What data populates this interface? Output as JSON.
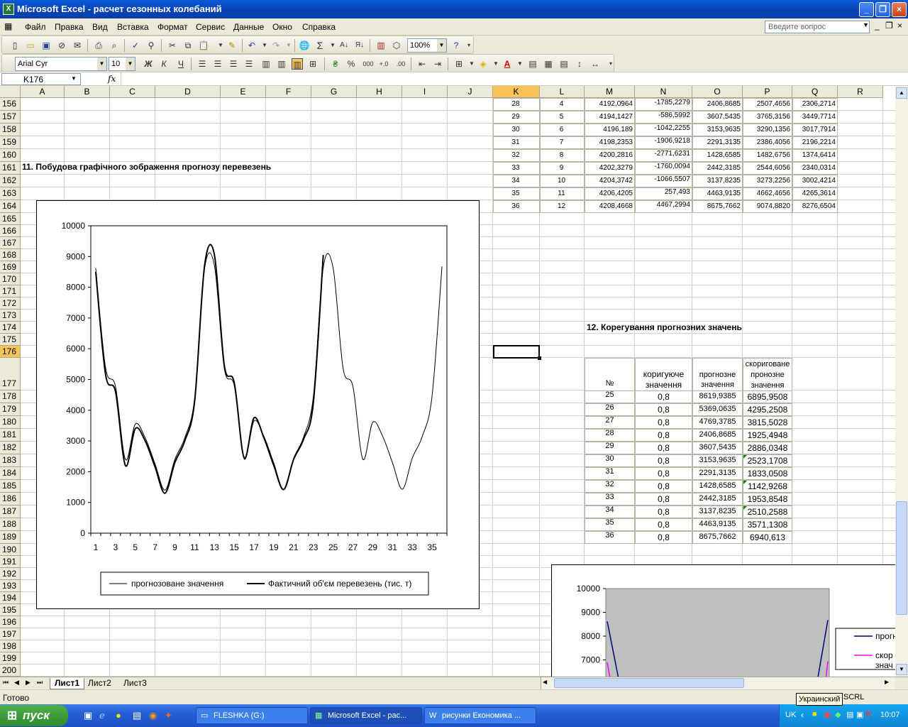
{
  "window": {
    "title": "Microsoft Excel - расчет сезонных колебаний"
  },
  "menu": [
    "Файл",
    "Правка",
    "Вид",
    "Вставка",
    "Формат",
    "Сервис",
    "Данные",
    "Окно",
    "Справка"
  ],
  "ask_placeholder": "Введите вопрос",
  "toolbar": {
    "zoom": "100%",
    "font": "Arial Cyr",
    "size": "10",
    "bold": "Ж",
    "italic": "К",
    "underline": "Ч",
    "percent": "%",
    "thousands": "000",
    "sigma": "Σ"
  },
  "namebox": "K176",
  "fx": "fx",
  "columns": [
    "A",
    "B",
    "C",
    "D",
    "E",
    "F",
    "G",
    "H",
    "I",
    "J",
    "K",
    "L",
    "M",
    "N",
    "O",
    "P",
    "Q",
    "R"
  ],
  "rows": [
    "156",
    "157",
    "158",
    "159",
    "160",
    "161",
    "162",
    "163",
    "164",
    "165",
    "166",
    "167",
    "168",
    "169",
    "170",
    "171",
    "172",
    "173",
    "174",
    "175",
    "176",
    "177",
    "178",
    "179",
    "180",
    "181",
    "182",
    "183",
    "184",
    "185",
    "186",
    "187",
    "188",
    "189",
    "190",
    "191",
    "192",
    "193",
    "194",
    "195",
    "196",
    "197",
    "198",
    "199",
    "200"
  ],
  "heading11": "11. Побудова графічного зображення  прогнозу перевезень",
  "heading12": "12. Корегування прогнозних значень",
  "table_top": [
    [
      "28",
      "4",
      "4192,0964",
      "-1785,2279",
      "2406,8685",
      "2507,4656",
      "2306,2714"
    ],
    [
      "29",
      "5",
      "4194,1427",
      "-586,5992",
      "3607,5435",
      "3765,3156",
      "3449,7714"
    ],
    [
      "30",
      "6",
      "4196,189",
      "-1042,2255",
      "3153,9635",
      "3290,1356",
      "3017,7914"
    ],
    [
      "31",
      "7",
      "4198,2353",
      "-1906,9218",
      "2291,3135",
      "2386,4056",
      "2196,2214"
    ],
    [
      "32",
      "8",
      "4200,2816",
      "-2771,6231",
      "1428,6585",
      "1482,6756",
      "1374,6414"
    ],
    [
      "33",
      "9",
      "4202,3279",
      "-1760,0094",
      "2442,3185",
      "2544,6056",
      "2340,0314"
    ],
    [
      "34",
      "10",
      "4204,3742",
      "-1066,5507",
      "3137,8235",
      "3273,2256",
      "3002,4214"
    ],
    [
      "35",
      "11",
      "4206,4205",
      "257,493",
      "4463,9135",
      "4662,4656",
      "4265,3614"
    ],
    [
      "36",
      "12",
      "4208,4668",
      "4467,2994",
      "8675,7662",
      "9074,8820",
      "8276,6504"
    ]
  ],
  "table2_headers": [
    "№",
    "коригуюче значення",
    "прогнозне значення",
    "скориговане пронозне значення"
  ],
  "table2": [
    [
      "25",
      "0,8",
      "8619,9385",
      "6895,9508"
    ],
    [
      "26",
      "0,8",
      "5369,0635",
      "4295,2508"
    ],
    [
      "27",
      "0,8",
      "4769,3785",
      "3815,5028"
    ],
    [
      "28",
      "0,8",
      "2406,8685",
      "1925,4948"
    ],
    [
      "29",
      "0,8",
      "3607,5435",
      "2886,0348"
    ],
    [
      "30",
      "0,8",
      "3153,9635",
      "2523,1708"
    ],
    [
      "31",
      "0,8",
      "2291,3135",
      "1833,0508"
    ],
    [
      "32",
      "0,8",
      "1428,6585",
      "1142,9268"
    ],
    [
      "33",
      "0,8",
      "2442,3185",
      "1953,8548"
    ],
    [
      "34",
      "0,8",
      "3137,8235",
      "2510,2588"
    ],
    [
      "35",
      "0,8",
      "4463,9135",
      "3571,1308"
    ],
    [
      "36",
      "0,8",
      "8675,7662",
      "6940,613"
    ]
  ],
  "chart_data": [
    {
      "type": "line",
      "x": [
        1,
        2,
        3,
        4,
        5,
        6,
        7,
        8,
        9,
        10,
        11,
        12,
        13,
        14,
        15,
        16,
        17,
        18,
        19,
        20,
        21,
        22,
        23,
        24,
        25,
        26,
        27,
        28,
        29,
        30,
        31,
        32,
        33,
        34,
        35,
        36
      ],
      "ylim": [
        0,
        10000
      ],
      "yticks": [
        "0",
        "1000",
        "2000",
        "3000",
        "4000",
        "5000",
        "6000",
        "7000",
        "8000",
        "9000",
        "10000"
      ],
      "xticks": [
        "1",
        "3",
        "5",
        "7",
        "9",
        "11",
        "13",
        "15",
        "17",
        "19",
        "21",
        "23",
        "25",
        "27",
        "29",
        "31",
        "33",
        "35"
      ],
      "series": [
        {
          "name": "прогнозоване значення",
          "color": "#000000",
          "width": 1,
          "values": [
            8620,
            5370,
            4770,
            2400,
            3550,
            3100,
            2250,
            1400,
            2400,
            3100,
            4400,
            8600,
            8700,
            5350,
            4800,
            2420,
            3650,
            3150,
            2280,
            1430,
            2430,
            3120,
            4450,
            8640,
            8620,
            5370,
            4770,
            2407,
            3608,
            3154,
            2291,
            1429,
            2442,
            3138,
            4464,
            8676
          ]
        },
        {
          "name": "Фактичний об'єм перевезень (тис. т)",
          "color": "#000000",
          "width": 2,
          "values": [
            8500,
            5150,
            4600,
            2200,
            3400,
            3000,
            2150,
            1300,
            2300,
            3000,
            4300,
            8700,
            9050,
            5450,
            4900,
            2450,
            3750,
            3100,
            2200,
            1420,
            2400,
            3050,
            4250,
            9050
          ]
        }
      ]
    },
    {
      "type": "line",
      "ylim": [
        0,
        10000
      ],
      "yticks": [
        "7000",
        "8000",
        "9000",
        "10000"
      ],
      "series": [
        {
          "name": "прогнозоване значення",
          "color": "#000080"
        },
        {
          "name": "скориговане прогнозне значення",
          "color": "#ff00ff"
        }
      ],
      "legend_visible": [
        "прогн",
        "скор",
        "знач"
      ]
    }
  ],
  "sheets": [
    "Лист1",
    "Лист2",
    "Лист3"
  ],
  "status": {
    "ready": "Готово",
    "scrl": "SCRL"
  },
  "taskbar": {
    "start": "пуск",
    "tasks": [
      "FLESHKA (G:)",
      "Microsoft Excel - рас...",
      "рисунки Економика ..."
    ],
    "lang": "UK",
    "clock": "10:07",
    "tooltip": "Украинский"
  }
}
